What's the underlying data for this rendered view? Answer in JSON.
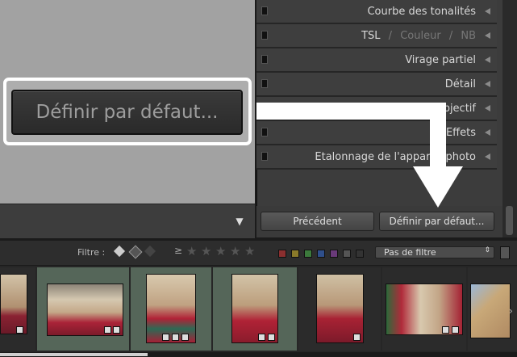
{
  "preview": {
    "zoom_button_label": "Définir par défaut..."
  },
  "toolbar": {
    "dropdown_icon": "chevron-down-icon"
  },
  "panel": {
    "rows": [
      {
        "label": "Courbe des tonalités"
      },
      {
        "label": "TSL",
        "sep1": "/",
        "part2": "Couleur",
        "sep2": "/",
        "part3": "NB"
      },
      {
        "label": "Virage partiel"
      },
      {
        "label": "Détail"
      },
      {
        "label": "Corrections de l'objectif"
      },
      {
        "label": "Effets"
      },
      {
        "label": "Etalonnage de l'appareil photo"
      }
    ],
    "previous_button": "Précédent",
    "set_default_button": "Définir par défaut..."
  },
  "filter_bar": {
    "label": "Filtre :",
    "rating_operator": "≥",
    "stars": 5,
    "color_labels": [
      "#8b2f2f",
      "#8a7a2a",
      "#3c7a3c",
      "#2f4f8b",
      "#6a3a7a",
      "#555555",
      "#333333"
    ],
    "preset": "Pas de filtre"
  },
  "filmstrip": {
    "thumbnails": 7,
    "scroll_position": 0.0
  },
  "colors": {
    "panel_bg": "#3e3e3e",
    "preview_bg": "#a2a2a2",
    "highlight_border": "#ffffff"
  }
}
